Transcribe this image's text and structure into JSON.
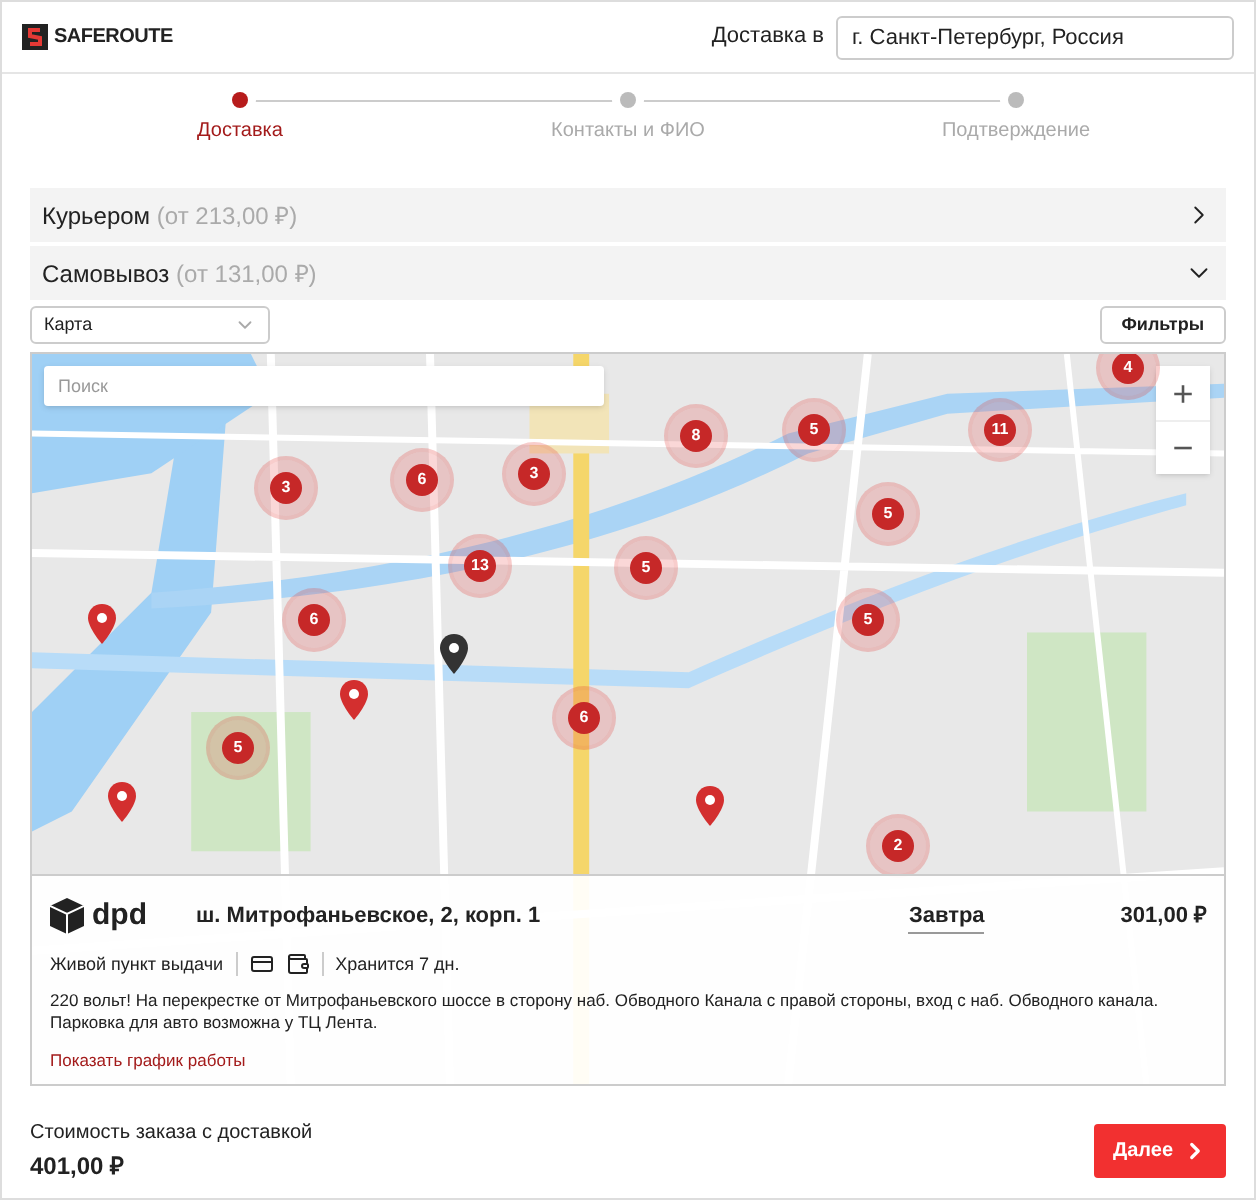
{
  "header": {
    "logo": "SAFEROUTE",
    "delivery_label": "Доставка в",
    "city": "г. Санкт-Петербург, Россия"
  },
  "steps": [
    {
      "label": "Доставка",
      "selected": true
    },
    {
      "label": "Контакты и ФИО",
      "selected": false
    },
    {
      "label": "Подтверждение",
      "selected": false
    }
  ],
  "methods": [
    {
      "name": "Курьером",
      "price": "(от 213,00 ₽)",
      "expanded": false
    },
    {
      "name": "Самовывоз",
      "price": "(от 131,00 ₽)",
      "expanded": true
    }
  ],
  "view_select": {
    "value": "Карта"
  },
  "filters_button": "Фильтры",
  "map": {
    "search_placeholder": "Поиск",
    "zoom_in": "+",
    "zoom_out": "−",
    "clusters": [
      "4",
      "8",
      "5",
      "11",
      "3",
      "6",
      "3",
      "5",
      "13",
      "5",
      "6",
      "5",
      "6",
      "5",
      "2"
    ],
    "pins": [
      {
        "kind": "point"
      },
      {
        "kind": "point"
      },
      {
        "kind": "point"
      },
      {
        "kind": "point"
      },
      {
        "kind": "selected"
      }
    ]
  },
  "point": {
    "carrier": "dpd",
    "address": "ш. Митрофаньевское, 2, корп. 1",
    "date": "Завтра",
    "price": "301,00 ₽",
    "type": "Живой пункт выдачи",
    "storage": "Хранится 7 дн.",
    "description": "220 вольт! На перекрестке от Митрофаньевского шоссе в сторону наб. Обводного Канала с правой стороны, вход с наб. Обводного канала. Парковка для авто возможна у ТЦ Лента.",
    "schedule_link": "Показать график работы"
  },
  "footer": {
    "total_label": "Стоимость заказа с доставкой",
    "total": "401,00 ₽",
    "next_button": "Далее"
  }
}
